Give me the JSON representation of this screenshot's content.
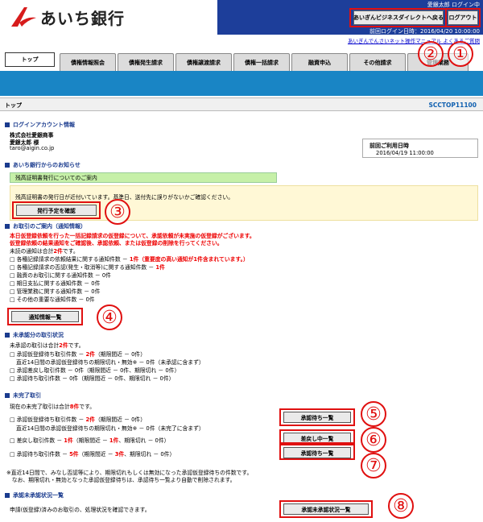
{
  "header": {
    "brand": "あいち銀行",
    "user_line": "愛銀太郎 ログイン中",
    "last_login": "前回ログイン日時：2016/04/20 10:00:00",
    "back_button": "あいぎんビジネスダイレクトへ戻る",
    "logout_button": "ログアウト",
    "help_links": "あいぎんでんさいネット操作マニュアル  よくあるご質問"
  },
  "tabs": [
    "トップ",
    "債権情報照会",
    "債権発生請求",
    "債権譲渡請求",
    "債権一括請求",
    "融資申込",
    "その他請求",
    "管理業務"
  ],
  "page": {
    "title": "トップ",
    "screen_id": "SCCTOP11100"
  },
  "login_account": {
    "heading": "ログインアカウント情報",
    "company": "株式会社愛銀商事",
    "user": "愛銀太郎 様",
    "email": "taro@aigin.co.jp",
    "last_use_label": "前回ご利用日時",
    "last_use_value": "2016/04/19 11:00:00"
  },
  "bank_notice": {
    "heading": "あいち銀行からのお知らせ",
    "item_title": "残高証明書発行についてのご案内",
    "item_body": "残高証明書の発行日が近付いています。基準日、送付先に誤りがないかご確認ください。",
    "button": "発行予定を確認"
  },
  "notifications": {
    "heading": "お取引のご案内（通知情報）",
    "warning1": "本日仮登録依頼を行った一括記録請求の仮登録について、承認依頼が未実施の仮登録がございます。",
    "warning2": "仮登録依頼の結果通知をご確認後、承認依頼、または仮登録の削除を行ってください。",
    "total_prefix": "未読の通知は合計",
    "total_count": "2件",
    "total_suffix": "です。",
    "items": [
      {
        "label": "□ 各種記録請求の依頼結果に関する通知件数 － ",
        "count": "1件",
        "note": "（重要度の高い通知が1件含まれています。）",
        "red": true
      },
      {
        "label": "□ 各種記録請求の否認(発生・取消等)に関する通知件数 － ",
        "count": "1件",
        "note": "",
        "red": true
      },
      {
        "label": "□ 融資のお取引に関する通知件数 － ",
        "count": "0件",
        "note": "",
        "red": false
      },
      {
        "label": "□ 期日支払に関する通知件数 － ",
        "count": "0件",
        "note": "",
        "red": false
      },
      {
        "label": "□ 管理業務に関する通知件数 － ",
        "count": "0件",
        "note": "",
        "red": false
      },
      {
        "label": "□ その他の重要な通知件数 － ",
        "count": "0件",
        "note": "",
        "red": false
      }
    ],
    "button": "通知情報一覧"
  },
  "unapproved": {
    "heading": "未承認分の取引状況",
    "total_prefix": "未承認の取引は合計",
    "total_count": "2件",
    "total_suffix": "です。",
    "line1_a": "□ 承認仮登録待ち取引件数 － ",
    "line1_count": "2件",
    "line1_b": "（期限間近 － 0件）",
    "line2": "直近14日間の承認仮登録待ちの期限切れ・無効※ － 0件（未承認に含まず）",
    "line3": "□ 承認差戻し取引件数 － 0件（期限間近 － 0件、期限切れ － 0件）",
    "line4": "□ 承認待ち取引件数 － 0件（期限間近 － 0件、期限切れ － 0件）"
  },
  "incomplete": {
    "heading": "未完了取引",
    "total_prefix": "現在の未完了取引は合計",
    "total_count": "8件",
    "total_suffix": "です。",
    "line1_a": "□ 承認仮登録待ち取引件数 － ",
    "line1_count": "2件",
    "line1_b": "（期限間近 － 0件）",
    "line2": "直近14日間の承認仮登録待ちの期限切れ・無効※ － 0件（未完了に含まず）",
    "line3_a": "□ 差戻し取引件数 － ",
    "line3_count": "1件",
    "line3_b": "（期限間近 － ",
    "line3_c": "1件",
    "line3_d": "、期限切れ － 0件）",
    "line4_a": "□ 承認待ち取引件数 － ",
    "line4_count": "5件",
    "line4_b": "（期限間近 － ",
    "line4_c": "3件",
    "line4_d": "、期限切れ － 0件）",
    "btn_approval_wait": "承認待ち一覧",
    "btn_returned": "差戻し中一覧",
    "btn_approval_wait2": "承認待ち一覧",
    "note1": "※直近14日間で、みなし否認等により、期限切れもしくは無効になった承認仮登録待ちの件数です。",
    "note2": "　なお、期限切れ・無効となった承認仮登録待ちは、承認待ち一覧より自動で削除されます。"
  },
  "unapproved_list": {
    "heading": "承認未承認状況一覧",
    "text": "申請(仮登録)済みのお取引の、処理状況を確認できます。",
    "button": "承認未承認状況一覧"
  },
  "annotations": [
    "①",
    "②",
    "③",
    "④",
    "⑤",
    "⑥",
    "⑦",
    "⑧"
  ]
}
